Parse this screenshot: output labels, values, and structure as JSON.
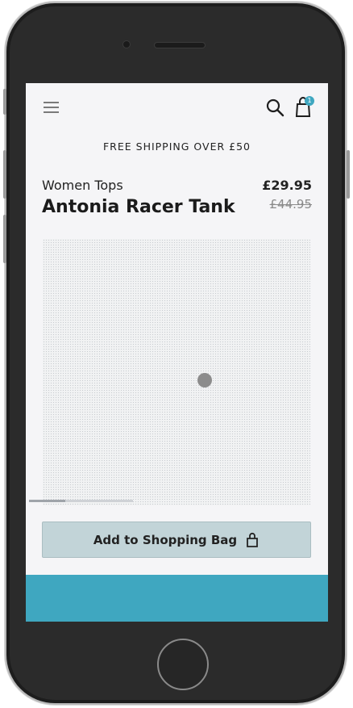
{
  "app": {
    "promo_text": "FREE SHIPPING OVER £50",
    "bag_count": "1"
  },
  "product": {
    "category": "Women Tops",
    "name": "Antonia Racer Tank",
    "price": "£29.95",
    "old_price": "£44.95",
    "gallery_progress": 0.35
  },
  "actions": {
    "add_to_bag_label": "Add to Shopping Bag"
  },
  "colors": {
    "accent": "#3fa7c0",
    "button_bg": "#c2d4d8"
  },
  "icons": {
    "menu": "menu-icon",
    "search": "search-icon",
    "bag": "shopping-bag-icon",
    "lock": "lock-icon"
  }
}
